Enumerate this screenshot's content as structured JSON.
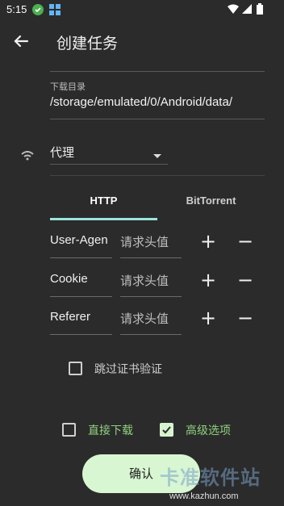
{
  "status_bar": {
    "time": "5:15"
  },
  "app_bar": {
    "title": "创建任务"
  },
  "download": {
    "label": "下载目录",
    "path": "/storage/emulated/0/Android/data/"
  },
  "proxy": {
    "label": "代理"
  },
  "tabs": [
    {
      "label": "HTTP",
      "selected": true
    },
    {
      "label": "BitTorrent",
      "selected": false
    }
  ],
  "headers": [
    {
      "key": "User-Agen",
      "value_placeholder": "请求头值"
    },
    {
      "key": "Cookie",
      "value_placeholder": "请求头值"
    },
    {
      "key": "Referer",
      "value_placeholder": "请求头值"
    }
  ],
  "skip_cert": {
    "label": "跳过证书验证",
    "checked": false
  },
  "direct_download": {
    "label": "直接下载",
    "checked": false
  },
  "advanced": {
    "label": "高级选项",
    "checked": true
  },
  "confirm": {
    "label": "确认"
  },
  "watermark": {
    "text": "卡准软件站",
    "url": "www.kazhun.com"
  },
  "colors": {
    "background": "#2b2b2b",
    "accent": "#98e5db",
    "green_label": "#8fd17e",
    "confirm_bg": "#d8f6d2"
  }
}
